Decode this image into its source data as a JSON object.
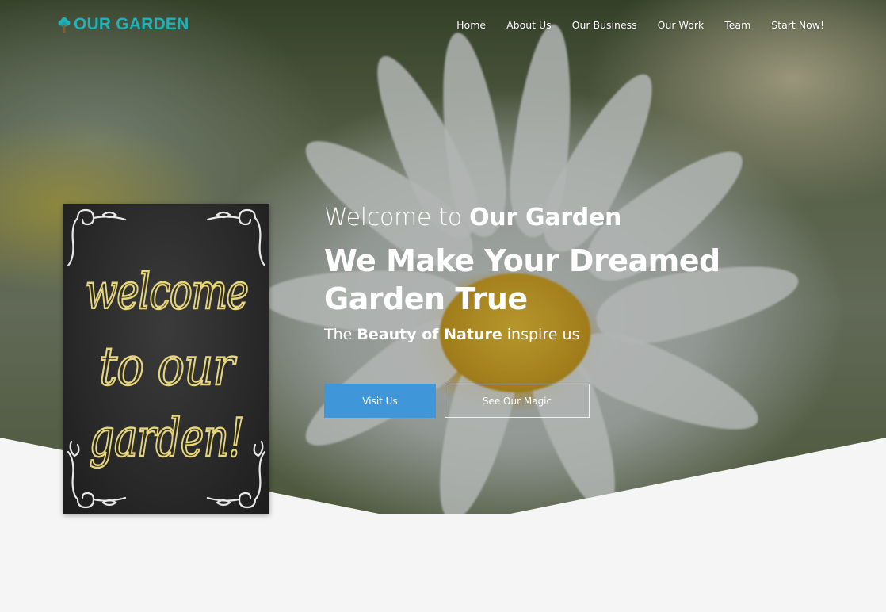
{
  "brand": {
    "name": "OUR GARDEN",
    "color": "#1fb2b8"
  },
  "nav": {
    "items": [
      {
        "label": "Home"
      },
      {
        "label": "About Us"
      },
      {
        "label": "Our Business"
      },
      {
        "label": "Our Work"
      },
      {
        "label": "Team"
      },
      {
        "label": "Start Now!"
      }
    ]
  },
  "hero": {
    "welcome_prefix": "Welcome to",
    "welcome_bold": "Our Garden",
    "headline": "We Make Your Dreamed Garden True",
    "tagline_prefix": "The",
    "tagline_bold": "Beauty of Nature",
    "tagline_suffix": "inspire us",
    "primary_button": "Visit Us",
    "secondary_button": "See Our Magic",
    "primary_color": "#3f97d9"
  },
  "poster": {
    "line1": "welcome",
    "line2": "to our",
    "line3": "garden!"
  }
}
